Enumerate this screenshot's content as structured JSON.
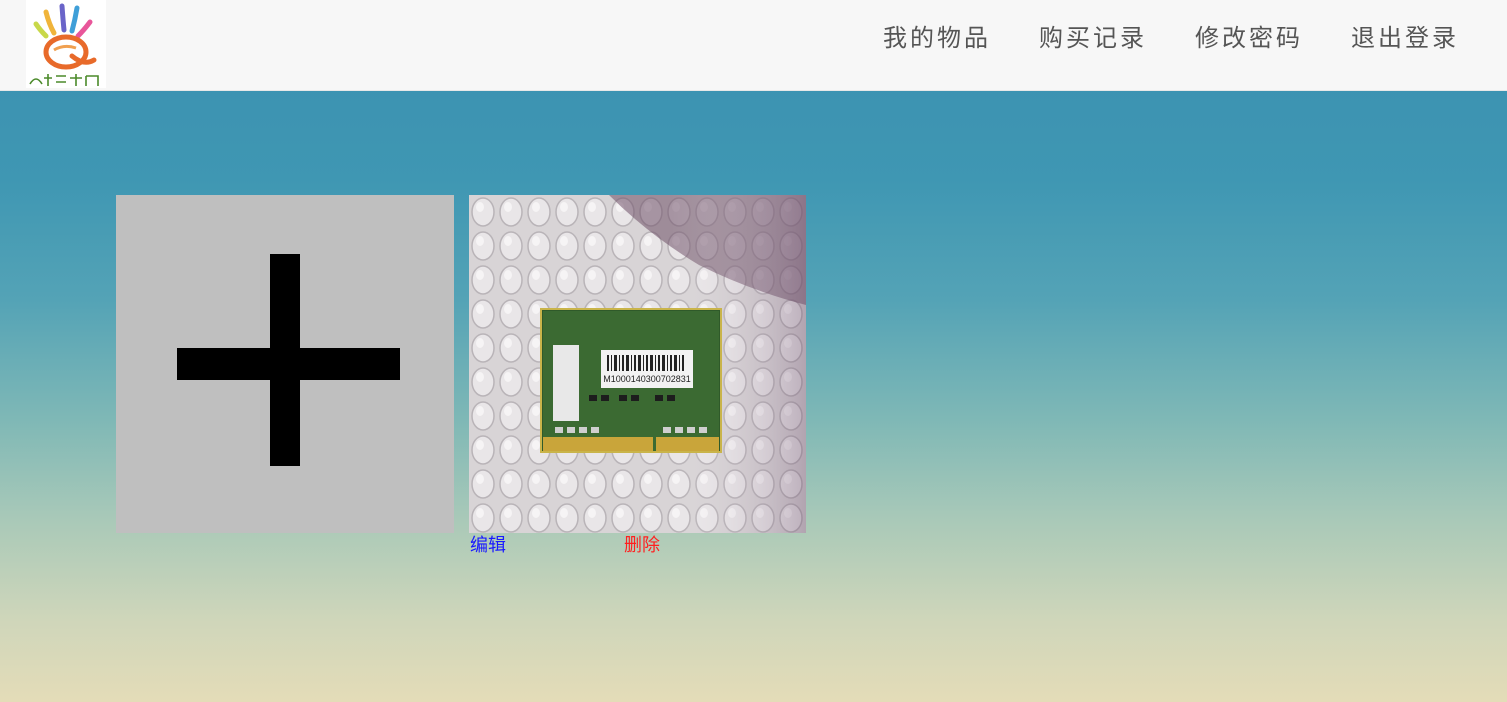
{
  "header": {
    "logo": {
      "icon": "colorful-hand-logo-icon",
      "text": "大学生二手网"
    },
    "nav": [
      {
        "label": "我的物品"
      },
      {
        "label": "购买记录"
      },
      {
        "label": "修改密码"
      },
      {
        "label": "退出登录"
      }
    ]
  },
  "main": {
    "add_tile": {
      "icon": "plus-icon"
    },
    "items": [
      {
        "image_icon": "ram-memory-module-photo",
        "barcode_text": "M1000140300702831",
        "edit_label": "编辑",
        "delete_label": "删除"
      }
    ]
  },
  "colors": {
    "nav_text": "#555555",
    "edit_link": "#1a1aff",
    "delete_link": "#ff2020",
    "add_tile_bg": "#bfbfbf",
    "header_bg": "#f7f7f7"
  }
}
